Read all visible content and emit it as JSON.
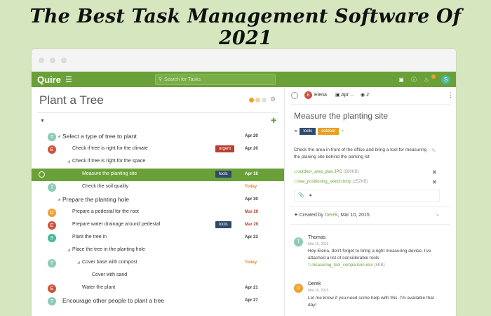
{
  "headline": "The Best Task Management Software Of 2021",
  "app": {
    "logo": "Quire",
    "search_placeholder": "Search for Tasks",
    "user_initial": "S"
  },
  "project": {
    "title": "Plant a Tree",
    "tasks": [
      {
        "name": "Select a type of tree to plant",
        "date": "Apr 20",
        "avatar": "T",
        "color": "#8ccbb8",
        "indent": 0,
        "caret": true,
        "big": true
      },
      {
        "name": "Check if tree is right for the climate",
        "date": "Apr 20",
        "avatar": "E",
        "color": "#d0533f",
        "indent": 1,
        "tag": "urgent",
        "tagColor": "#b84030"
      },
      {
        "name": "Check if tree is right for the space",
        "date": "",
        "avatar": "",
        "color": "",
        "indent": 1,
        "caret": true
      },
      {
        "name": "Measure the planting site",
        "date": "Apr 18",
        "avatar": "",
        "color": "",
        "indent": 2,
        "tag": "tools",
        "tagColor": "#2f4a6a",
        "active": true
      },
      {
        "name": "Check the soil quality",
        "date": "Today",
        "avatar": "T",
        "color": "#8ccbb8",
        "indent": 2,
        "dateColor": "#e08a20"
      },
      {
        "name": "Prepare the planting hole",
        "date": "Apr 30",
        "avatar": "",
        "color": "",
        "indent": 0,
        "caret": true,
        "big": true
      },
      {
        "name": "Prepare a pedestal for the root",
        "date": "Mar 29",
        "avatar": "D",
        "color": "#f0a030",
        "indent": 1,
        "dateColor": "#c0392b"
      },
      {
        "name": "Prepare water drainage around pedestal",
        "date": "Mar 29",
        "avatar": "E",
        "color": "#d0533f",
        "indent": 1,
        "tag": "tools",
        "tagColor": "#2f4a6a",
        "dateColor": "#c0392b"
      },
      {
        "name": "Plant the tree in",
        "date": "Apr 23",
        "avatar": "S",
        "color": "#4bb89a",
        "indent": 1
      },
      {
        "name": "Place the tree in the planting hole",
        "date": "",
        "avatar": "",
        "color": "",
        "indent": 1,
        "caret": true
      },
      {
        "name": "Cover base with compost",
        "date": "Today",
        "avatar": "T",
        "color": "#8ccbb8",
        "indent": 2,
        "caret": true,
        "dateColor": "#e08a20"
      },
      {
        "name": "Cover with sand",
        "date": "",
        "avatar": "",
        "color": "",
        "indent": 3
      },
      {
        "name": "Water the plant",
        "date": "Apr 21",
        "avatar": "E",
        "color": "#d0533f",
        "indent": 2
      },
      {
        "name": "Encourage other people to plant a tree",
        "date": "Apr 27",
        "avatar": "T",
        "color": "#8ccbb8",
        "indent": 0,
        "big": true
      }
    ]
  },
  "detail": {
    "assignee": "Elena",
    "assignee_initial": "E",
    "due": "Apr ...",
    "watchers": "2",
    "title": "Measure the planting site",
    "tags": [
      {
        "label": "tools",
        "color": "#2f4a6a"
      },
      {
        "label": "outdoor",
        "color": "#e8a020"
      }
    ],
    "description": "Check the area in front of the office and bring a tool for measuring the planing site behind the parking lot",
    "files": [
      {
        "name": "outdoor_area_plan.JPG",
        "size": "(580KB)"
      },
      {
        "name": "tree_positioning_sketch.bmp",
        "size": "(152KB)"
      }
    ],
    "created_prefix": "Created by ",
    "created_by": "Derek",
    "created_date": ", Mar 10, 2015",
    "comments": [
      {
        "initial": "T",
        "color": "#8ccbb8",
        "name": "Thomas",
        "time": "Mar 15, 2015",
        "text": "Hey Elena, don't forget to bring a right measuring device. I've attached a list of considerable tools",
        "file": "measuring_tool_comparison.xlsx",
        "file_size": "(8KB)"
      },
      {
        "initial": "D",
        "color": "#f0a030",
        "name": "Derek",
        "time": "Mar 15, 2015",
        "text": "Let me know if you need some help with this. I'm available that day!"
      }
    ]
  }
}
